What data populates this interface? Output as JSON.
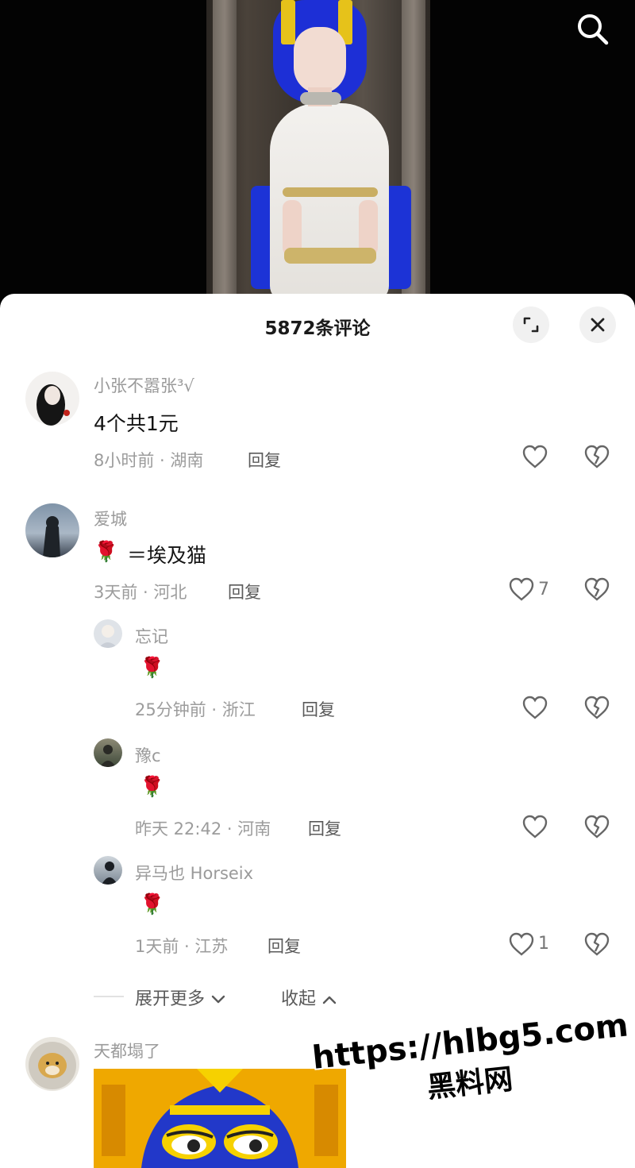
{
  "header": {
    "comment_count": "5872条评论"
  },
  "icons": {
    "search": "search-icon",
    "expand": "expand-icon",
    "close": "close-icon",
    "like": "heart-icon",
    "dislike": "broken-heart-icon"
  },
  "comments": [
    {
      "user": "小张不嚣张³√",
      "text": "4个共1元",
      "meta": "8小时前 · 湖南",
      "reply": "回复",
      "likes": ""
    },
    {
      "user": "爱城",
      "emoji": "🌹",
      "text": "＝埃及猫",
      "meta": "3天前 · 河北",
      "reply": "回复",
      "likes": "7"
    },
    {
      "user": "天都塌了",
      "text": ""
    }
  ],
  "replies": [
    {
      "user": "忘记",
      "emoji": "🌹",
      "meta": "25分钟前 · 浙江",
      "reply": "回复",
      "likes": ""
    },
    {
      "user": "豫c",
      "emoji": "🌹",
      "meta": "昨天 22:42 · 河南",
      "reply": "回复",
      "likes": ""
    },
    {
      "user": "异马也 Horseix",
      "emoji": "🌹",
      "meta": "1天前 · 江苏",
      "reply": "回复",
      "likes": "1"
    }
  ],
  "thread_controls": {
    "expand": "展开更多",
    "collapse": "收起"
  },
  "watermark": {
    "url": "https://hlbg5.com",
    "name": "黑料网"
  },
  "colors": {
    "sheet_bg": "#ffffff",
    "video_bg": "#030303",
    "muted_text": "#9a9a9a",
    "hair_blue": "#1d2fd6"
  }
}
